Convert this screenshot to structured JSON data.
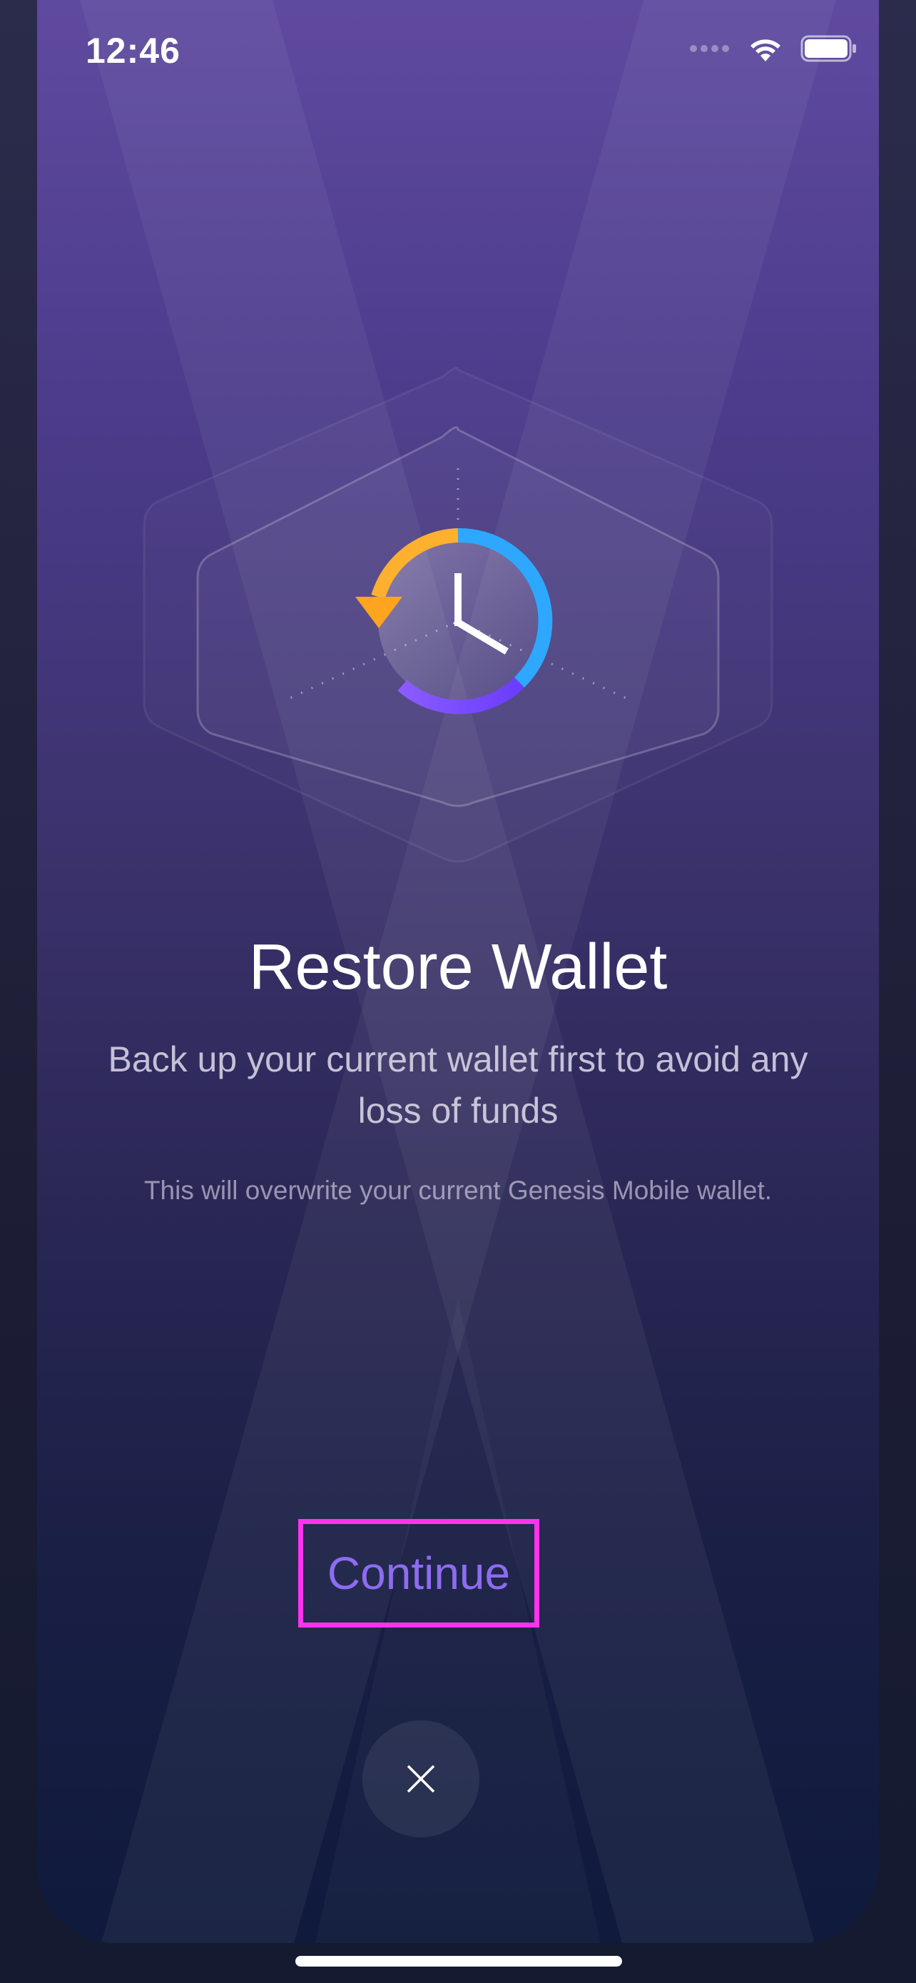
{
  "status_bar": {
    "time": "12:46",
    "icons": [
      "signal-dots-icon",
      "wifi-icon",
      "battery-icon"
    ]
  },
  "screen": {
    "hero_icon": "restore-clock-icon",
    "title": "Restore Wallet",
    "subtitle": "Back up your current wallet first to avoid any loss of funds",
    "note": "This will overwrite your current Genesis Mobile wallet.",
    "continue_label": "Continue",
    "close_icon": "close-icon"
  },
  "colors": {
    "accent": "#8d6cf0",
    "highlight_border": "#ff33ee",
    "arc_orange": "#ffb02e",
    "arc_blue": "#2ea8ff",
    "arc_purple": "#7b4dff"
  }
}
